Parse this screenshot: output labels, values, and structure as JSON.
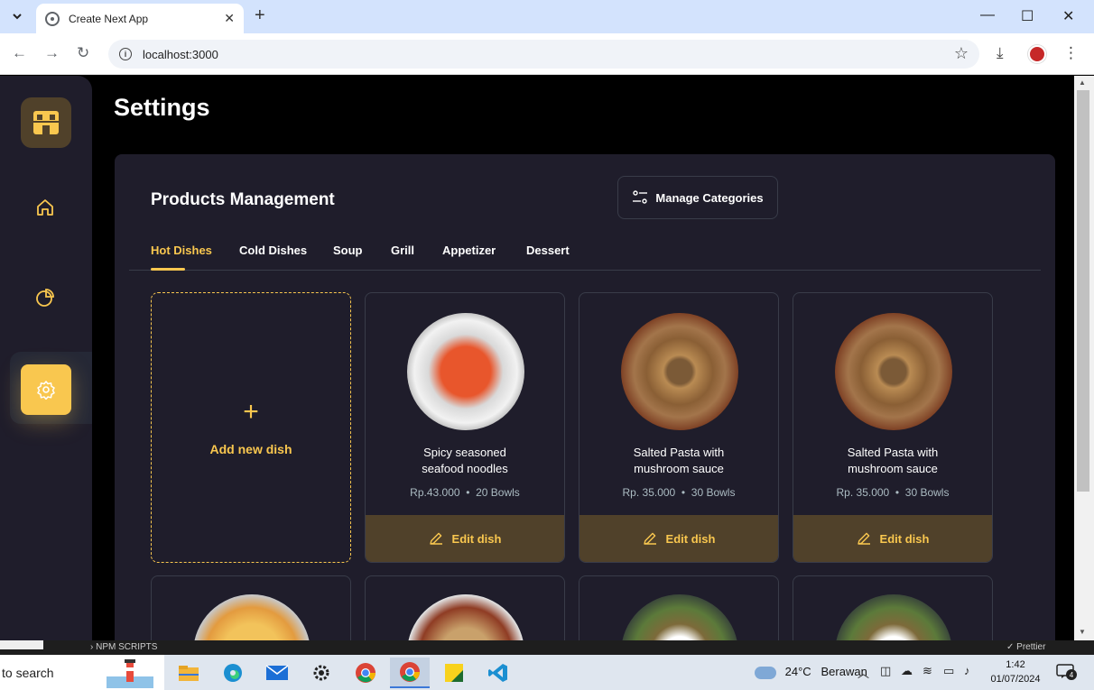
{
  "browser": {
    "tab_title": "Create Next App",
    "url": "localhost:3000"
  },
  "page": {
    "title": "Settings"
  },
  "products": {
    "panel_title": "Products Management",
    "manage_label": "Manage Categories",
    "categories": [
      "Hot Dishes",
      "Cold Dishes",
      "Soup",
      "Grill",
      "Appetizer",
      "Dessert"
    ],
    "active_category": "Hot Dishes",
    "add_label": "Add new dish",
    "add_plus": "+",
    "edit_label": "Edit dish",
    "dishes": [
      {
        "name": "Spicy seasoned seafood noodles",
        "price": "Rp.43.000",
        "stock": "20 Bowls"
      },
      {
        "name": "Salted Pasta with mushroom sauce",
        "price": "Rp. 35.000",
        "stock": "30 Bowls"
      },
      {
        "name": "Salted Pasta with mushroom sauce",
        "price": "Rp. 35.000",
        "stock": "30 Bowls"
      }
    ],
    "meta_separator": "•"
  },
  "vscode": {
    "npm_scripts": "NPM SCRIPTS",
    "prettier": "Prettier"
  },
  "taskbar": {
    "search_text": "to search",
    "weather_temp": "24°C",
    "weather_desc": "Berawan",
    "time": "1:42",
    "date": "01/07/2024",
    "notification_count": "4"
  },
  "colors": {
    "accent": "#f9c74f",
    "panel": "#1f1d2b",
    "edit_bar": "#50412a",
    "muted_text": "#abbbc2"
  }
}
